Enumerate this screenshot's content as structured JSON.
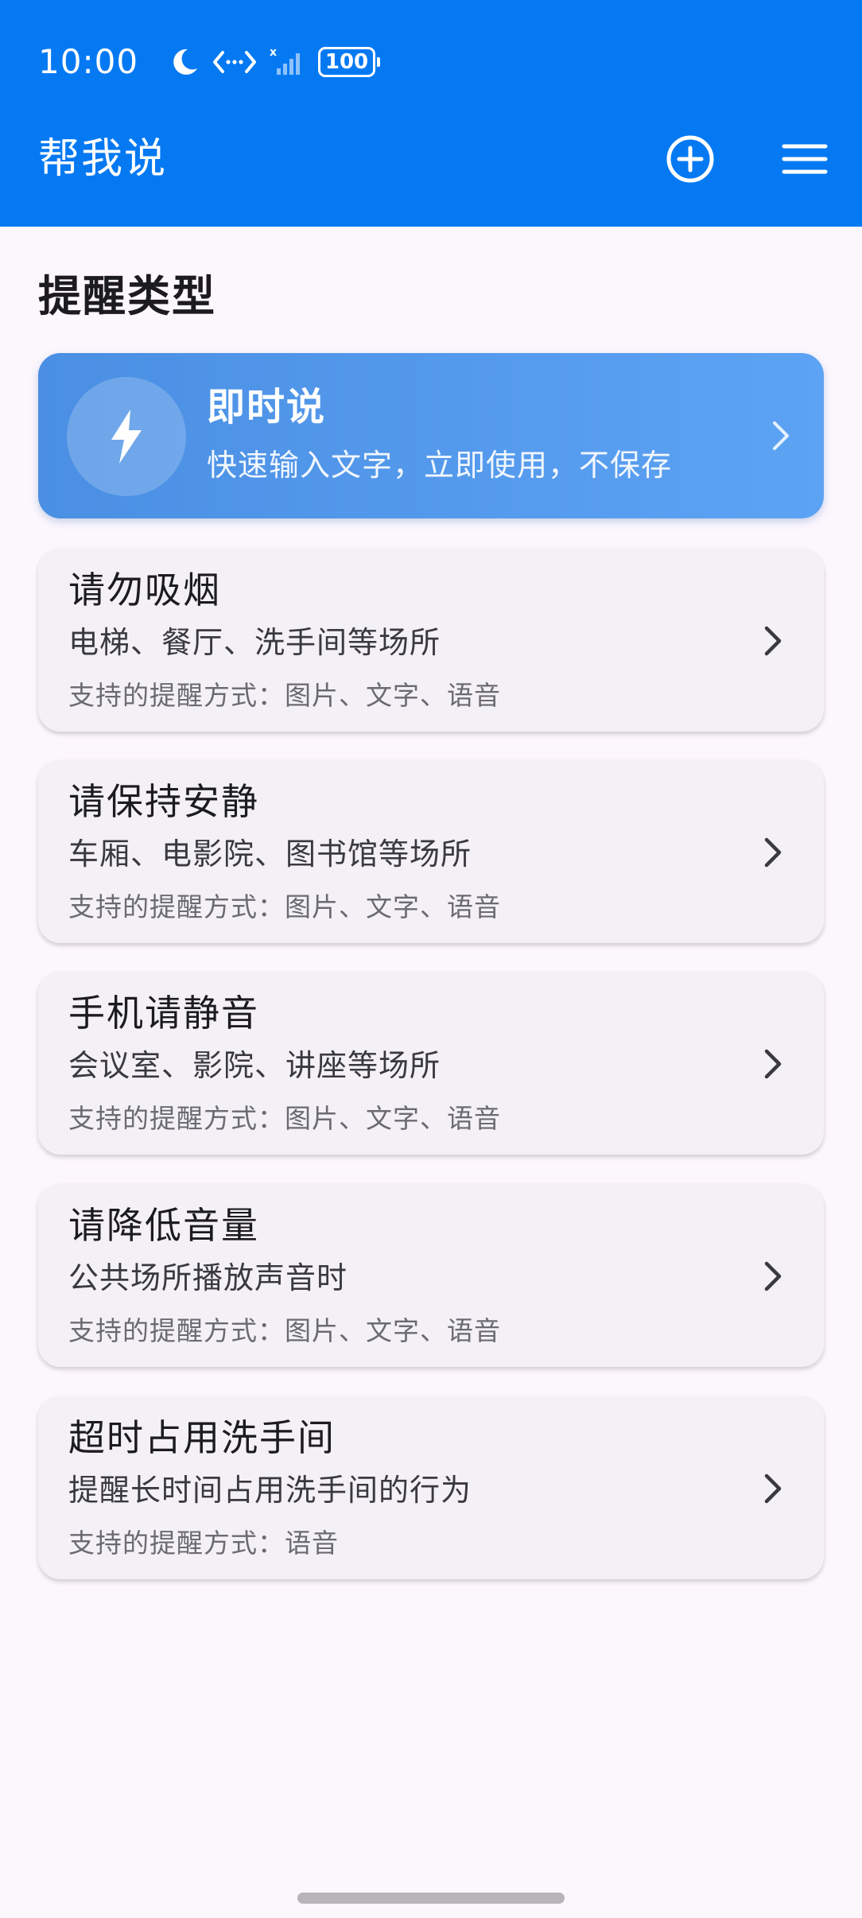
{
  "status_bar": {
    "time": "10:00",
    "battery": "100",
    "icons": [
      "moon-icon",
      "data-transfer-icon",
      "signal-icon",
      "battery-icon"
    ]
  },
  "app_bar": {
    "title": "帮我说",
    "actions": [
      "add-circle-icon",
      "menu-icon"
    ]
  },
  "section": {
    "title": "提醒类型"
  },
  "instant": {
    "title": "即时说",
    "subtitle": "快速输入文字，立即使用，不保存",
    "icon": "lightning-icon"
  },
  "reminders": [
    {
      "title": "请勿吸烟",
      "description": "电梯、餐厅、洗手间等场所",
      "support": "支持的提醒方式：图片、文字、语音"
    },
    {
      "title": "请保持安静",
      "description": "车厢、电影院、图书馆等场所",
      "support": "支持的提醒方式：图片、文字、语音"
    },
    {
      "title": "手机请静音",
      "description": "会议室、影院、讲座等场所",
      "support": "支持的提醒方式：图片、文字、语音"
    },
    {
      "title": "请降低音量",
      "description": "公共场所播放声音时",
      "support": "支持的提醒方式：图片、文字、语音"
    },
    {
      "title": "超时占用洗手间",
      "description": "提醒长时间占用洗手间的行为",
      "support": "支持的提醒方式：语音"
    }
  ],
  "colors": {
    "primary": "#0579f2",
    "background": "#fcf7fd",
    "card": "#f4f1f6",
    "instant_gradient_start": "#4a8fe3",
    "instant_gradient_end": "#5da3f4"
  }
}
